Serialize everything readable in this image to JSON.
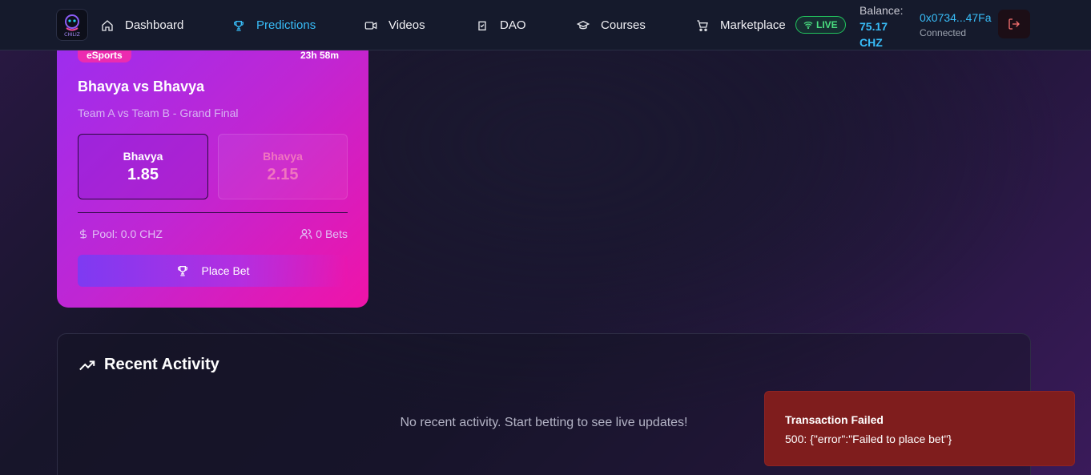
{
  "nav": {
    "logo_text": "CHILIZ",
    "items": [
      {
        "label": "Dashboard",
        "icon": "home-icon"
      },
      {
        "label": "Predictions",
        "icon": "trophy-icon",
        "active": true
      },
      {
        "label": "Videos",
        "icon": "video-icon"
      },
      {
        "label": "DAO",
        "icon": "vote-icon"
      },
      {
        "label": "Courses",
        "icon": "graduation-cap-icon"
      },
      {
        "label": "Marketplace",
        "icon": "cart-icon"
      }
    ],
    "live_label": "LIVE",
    "balance_label": "Balance:",
    "balance_value": "75.17 CHZ",
    "wallet_address": "0x0734...47Fa",
    "wallet_status": "Connected",
    "logout_icon": "logout-icon"
  },
  "card": {
    "category": "eSports",
    "time_left": "23h 58m",
    "title": "Bhavya vs Bhavya",
    "subtitle": "Team A vs Team B - Grand Final",
    "options": [
      {
        "name": "Bhavya",
        "odds": "1.85"
      },
      {
        "name": "Bhavya",
        "odds": "2.15"
      }
    ],
    "pool": "Pool: 0.0 CHZ",
    "bets": "0 Bets",
    "place_bet_label": "Place Bet"
  },
  "recent_activity": {
    "title": "Recent Activity",
    "empty_message": "No recent activity. Start betting to see live updates!"
  },
  "toast": {
    "title": "Transaction Failed",
    "message": "500: {\"error\":\"Failed to place bet\"}"
  },
  "colors": {
    "accent": "#38bdf8",
    "live": "#22c55e",
    "card_start": "#9b2ef0",
    "card_end": "#f013a8",
    "toast_bg": "#7f1d1d"
  }
}
